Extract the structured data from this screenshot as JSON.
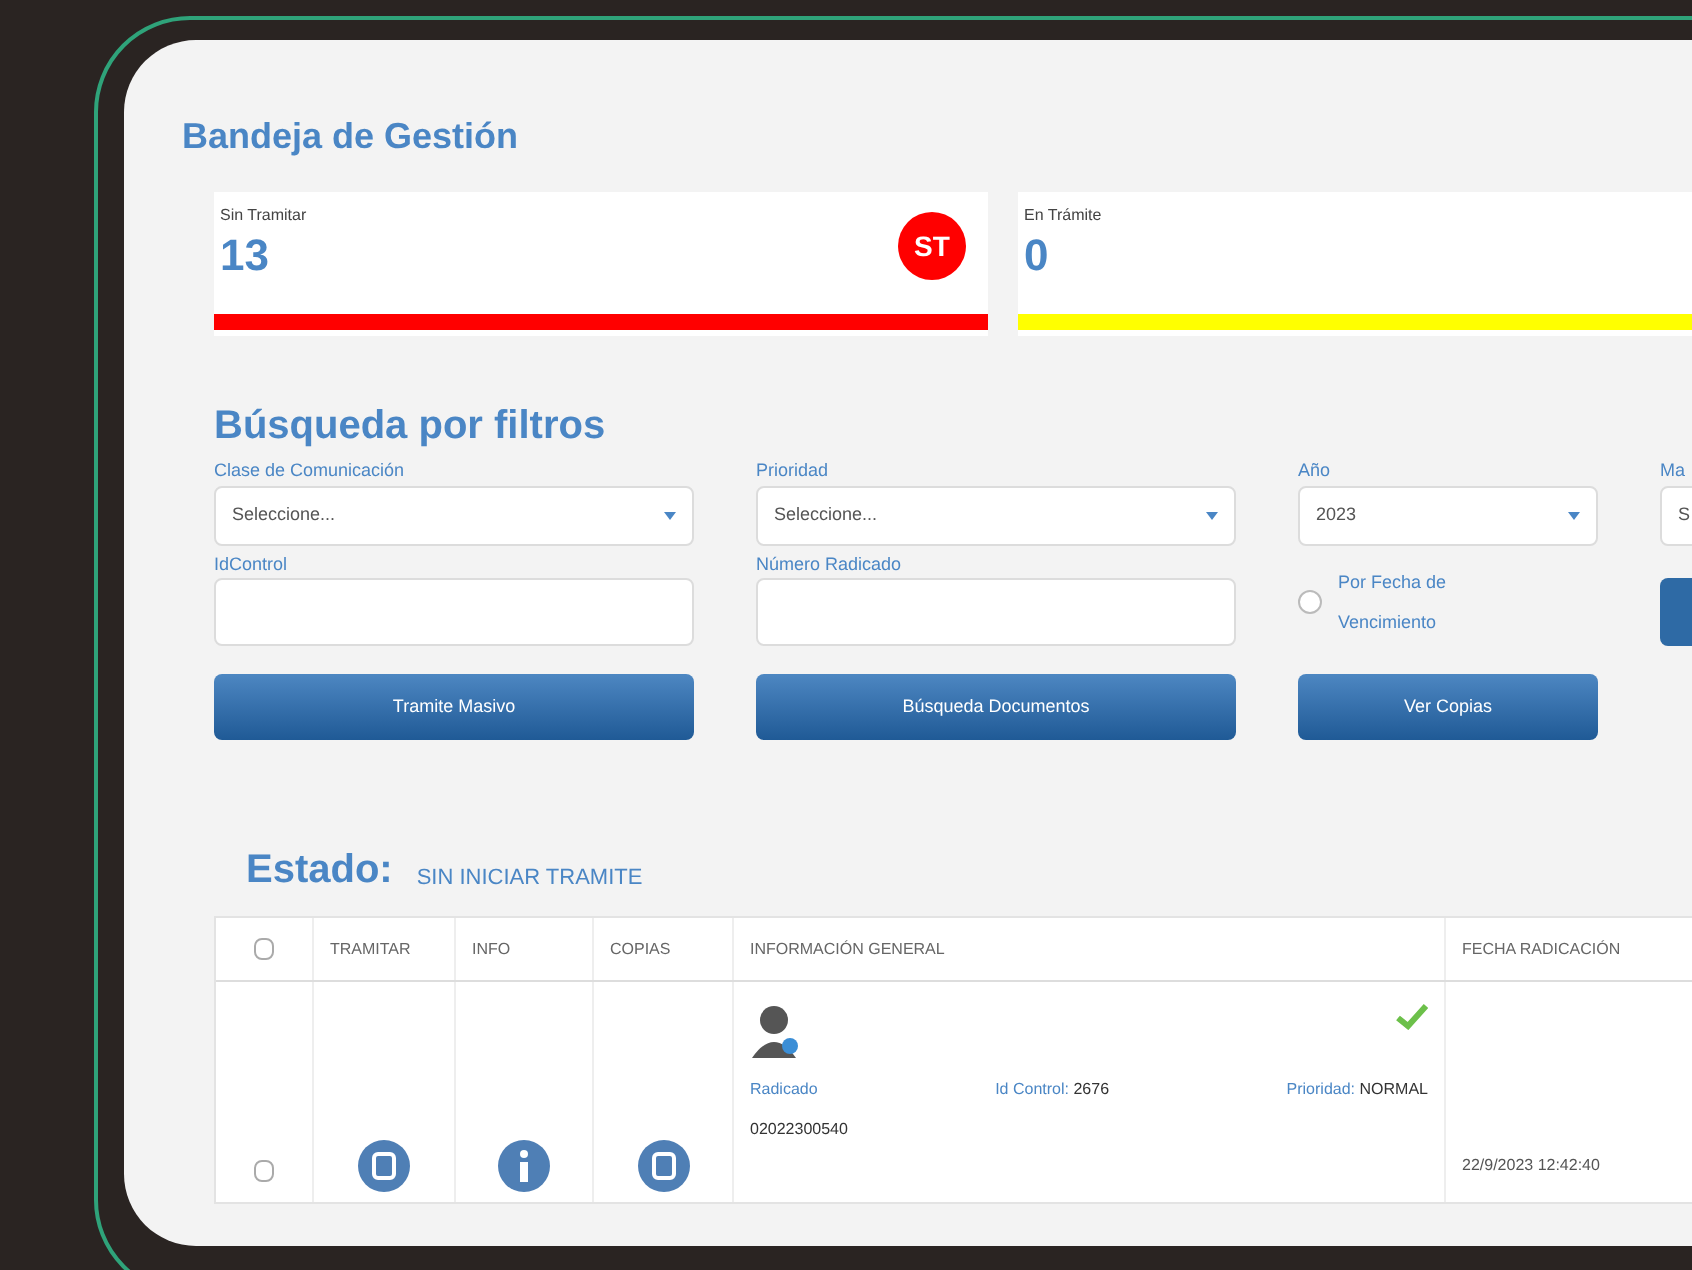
{
  "title": "Bandeja de Gestión",
  "cards": [
    {
      "label": "Sin Tramitar",
      "value": "13",
      "badge": "ST",
      "color": "#ff0000"
    },
    {
      "label": "En Trámite",
      "value": "0",
      "color": "#ffff00"
    }
  ],
  "filters": {
    "title": "Búsqueda por filtros",
    "fields": [
      {
        "kind": "select",
        "label": "Clase de Comunicación",
        "value": "Seleccione..."
      },
      {
        "kind": "select",
        "label": "Prioridad",
        "value": "Seleccione..."
      },
      {
        "kind": "select",
        "label": "Año",
        "value": "2023"
      },
      {
        "kind": "select",
        "label": "Ma",
        "value": "S"
      },
      {
        "kind": "input",
        "label": "IdControl"
      },
      {
        "kind": "input",
        "label": "Número Radicado"
      },
      {
        "kind": "checkbox",
        "label": "Por Fecha de Vencimiento",
        "checked": false
      }
    ],
    "buttons": [
      "Tramite Masivo",
      "Búsqueda Documentos",
      "Ver Copias"
    ]
  },
  "estado": {
    "label": "Estado:",
    "value": "SIN INICIAR TRAMITE"
  },
  "table": {
    "columns": [
      "TRAMITAR",
      "INFO",
      "COPIAS",
      "INFORMACIÓN GENERAL",
      "FECHA RADICACIÓN"
    ],
    "select_all_checked": false,
    "rows": [
      {
        "checked": false,
        "link": "Radicado",
        "id_label": "Id Control:",
        "id_value": "2676",
        "prio_label": "Prioridad:",
        "prio_value": "NORMAL",
        "number": "02022300540",
        "date": "22/9/2023 12:42:40",
        "done": true
      }
    ]
  }
}
